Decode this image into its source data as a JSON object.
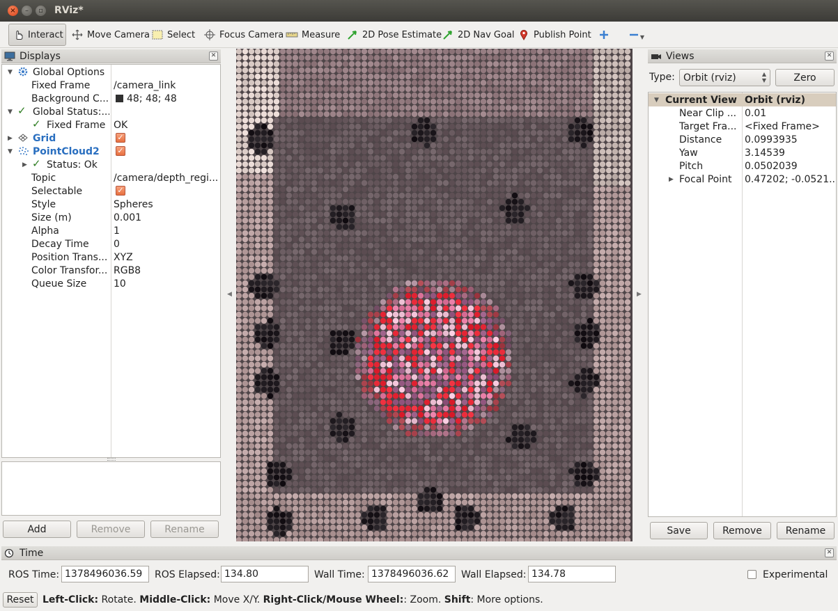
{
  "window": {
    "title": "RViz*",
    "close_glyph": "×",
    "min_glyph": "–",
    "max_glyph": "▫"
  },
  "toolbar": {
    "interact": "Interact",
    "move_camera": "Move Camera",
    "select": "Select",
    "focus_camera": "Focus Camera",
    "measure": "Measure",
    "pose_estimate": "2D Pose Estimate",
    "nav_goal": "2D Nav Goal",
    "publish_point": "Publish Point"
  },
  "displays": {
    "title": "Displays",
    "rows": [
      {
        "name": "Global Options",
        "value": ""
      },
      {
        "name": "Fixed Frame",
        "value": "/camera_link"
      },
      {
        "name": "Background C...",
        "value": "48; 48; 48"
      },
      {
        "name": "Global Status:...",
        "value": ""
      },
      {
        "name": "Fixed Frame",
        "value": "OK"
      },
      {
        "name": "Grid",
        "value": ""
      },
      {
        "name": "PointCloud2",
        "value": ""
      },
      {
        "name": "Status: Ok",
        "value": ""
      },
      {
        "name": "Topic",
        "value": "/camera/depth_regi..."
      },
      {
        "name": "Selectable",
        "value": ""
      },
      {
        "name": "Style",
        "value": "Spheres"
      },
      {
        "name": "Size (m)",
        "value": "0.001"
      },
      {
        "name": "Alpha",
        "value": "1"
      },
      {
        "name": "Decay Time",
        "value": "0"
      },
      {
        "name": "Position Trans...",
        "value": "XYZ"
      },
      {
        "name": "Color Transfor...",
        "value": "RGB8"
      },
      {
        "name": "Queue Size",
        "value": "10"
      }
    ],
    "background_color": "#303030",
    "buttons": {
      "add": "Add",
      "remove": "Remove",
      "rename": "Rename"
    }
  },
  "views": {
    "title": "Views",
    "type_label": "Type:",
    "type_value": "Orbit (rviz)",
    "zero": "Zero",
    "header": {
      "name": "Current View",
      "value": "Orbit (rviz)"
    },
    "rows": [
      {
        "name": "Near Clip ...",
        "value": "0.01"
      },
      {
        "name": "Target Fra...",
        "value": "<Fixed Frame>"
      },
      {
        "name": "Distance",
        "value": "0.0993935"
      },
      {
        "name": "Yaw",
        "value": "3.14539"
      },
      {
        "name": "Pitch",
        "value": "0.0502039"
      },
      {
        "name": "Focal Point",
        "value": "0.47202; -0.0521..."
      }
    ],
    "buttons": {
      "save": "Save",
      "remove": "Remove",
      "rename": "Rename"
    }
  },
  "time": {
    "title": "Time",
    "ros_time_label": "ROS Time:",
    "ros_time": "1378496036.59",
    "ros_elapsed_label": "ROS Elapsed:",
    "ros_elapsed": "134.80",
    "wall_time_label": "Wall Time:",
    "wall_time": "1378496036.62",
    "wall_elapsed_label": "Wall Elapsed:",
    "wall_elapsed": "134.78",
    "experimental": "Experimental"
  },
  "status": {
    "reset": "Reset",
    "left_click": "Left-Click:",
    "left_click_desc": " Rotate. ",
    "middle_click": "Middle-Click:",
    "middle_click_desc": " Move X/Y. ",
    "right_click": "Right-Click/Mouse Wheel:",
    "right_click_desc": ": Zoom. ",
    "shift": "Shift",
    "shift_desc": ": More options."
  },
  "colors": {
    "accent_blue": "#2a6fc0",
    "check_orange": "#e8703f",
    "check_green": "#2e7d22"
  }
}
